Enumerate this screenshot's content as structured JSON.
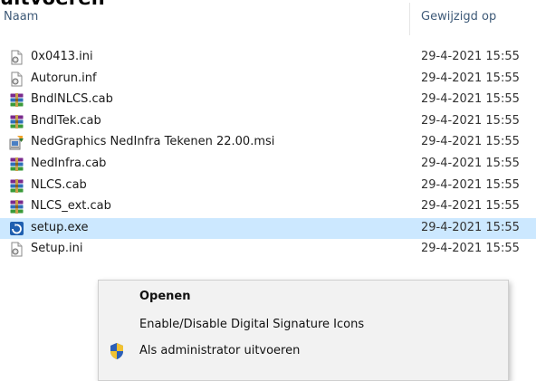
{
  "folder_heading": "uitvoeren",
  "columns": {
    "name": "Naam",
    "modified": "Gewijzigd op"
  },
  "files": [
    {
      "name": "0x0413.ini",
      "date": "29-4-2021 15:55",
      "icon": "settings-file-icon"
    },
    {
      "name": "Autorun.inf",
      "date": "29-4-2021 15:55",
      "icon": "settings-file-icon"
    },
    {
      "name": "BndlNLCS.cab",
      "date": "29-4-2021 15:55",
      "icon": "archive-icon"
    },
    {
      "name": "BndlTek.cab",
      "date": "29-4-2021 15:55",
      "icon": "archive-icon"
    },
    {
      "name": "NedGraphics NedInfra Tekenen 22.00.msi",
      "date": "29-4-2021 15:55",
      "icon": "installer-icon"
    },
    {
      "name": "NedInfra.cab",
      "date": "29-4-2021 15:55",
      "icon": "archive-icon"
    },
    {
      "name": "NLCS.cab",
      "date": "29-4-2021 15:55",
      "icon": "archive-icon"
    },
    {
      "name": "NLCS_ext.cab",
      "date": "29-4-2021 15:55",
      "icon": "archive-icon"
    },
    {
      "name": "setup.exe",
      "date": "29-4-2021 15:55",
      "icon": "setup-exe-icon",
      "selected": true
    },
    {
      "name": "Setup.ini",
      "date": "29-4-2021 15:55",
      "icon": "settings-file-icon"
    }
  ],
  "context_menu": {
    "items": [
      {
        "label": "Openen",
        "bold": true,
        "icon": ""
      },
      {
        "label": "Enable/Disable Digital Signature Icons",
        "bold": false,
        "icon": ""
      },
      {
        "label": "Als administrator uitvoeren",
        "bold": false,
        "icon": "uac-shield-icon"
      }
    ]
  },
  "colors": {
    "selection": "#cce8ff",
    "header_text": "#3e5a78",
    "menu_background": "#f2f2f2"
  }
}
